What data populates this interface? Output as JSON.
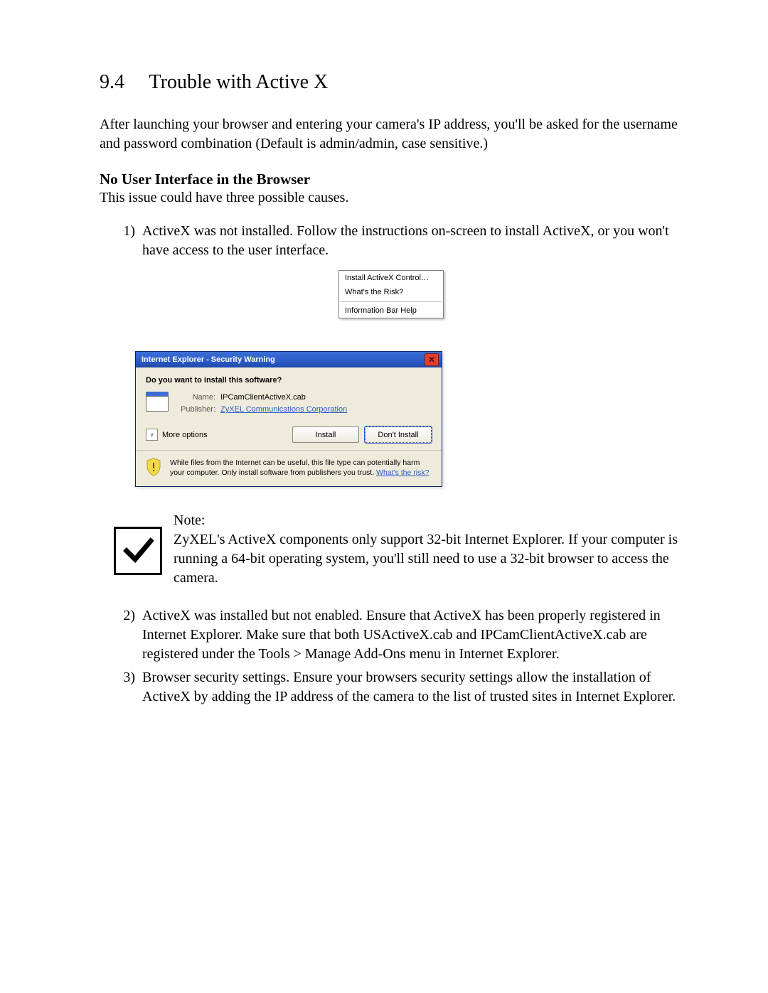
{
  "section": {
    "number": "9.4",
    "title": "Trouble with Active X"
  },
  "intro": "After launching your browser and entering your camera's IP address, you'll be asked for the username and password combination (Default is admin/admin, case sensitive.)",
  "subhead": "No User Interface in the Browser",
  "sublead": "This issue could have three possible causes.",
  "steps": {
    "s1": {
      "marker": "1)",
      "text": "ActiveX was not installed. Follow the instructions on-screen to install ActiveX, or you won't have access to the user interface."
    },
    "s2": {
      "marker": "2)",
      "text": "ActiveX was installed but not enabled. Ensure that ActiveX has been properly registered in Internet Explorer. Make sure that both USActiveX.cab and IPCamClientActiveX.cab are registered under the Tools > Manage Add-Ons menu in Internet Explorer."
    },
    "s3": {
      "marker": "3)",
      "text": "Browser security settings. Ensure your browsers security settings allow the installation of ActiveX by adding the IP address of the camera to the list of trusted sites in Internet Explorer."
    }
  },
  "context_menu": {
    "install": "Install ActiveX Control…",
    "risk": "What's the Risk?",
    "help": "Information Bar Help"
  },
  "dialog": {
    "title": "Internet Explorer - Security Warning",
    "question": "Do you want to install this software?",
    "name_label": "Name:",
    "name_value": "IPCamClientActiveX.cab",
    "publisher_label": "Publisher:",
    "publisher_value": "ZyXEL Communications Corporation",
    "more_options": "More options",
    "install_btn": "Install",
    "dont_install_btn": "Don't Install",
    "footer_text": "While files from the Internet can be useful, this file type can potentially harm your computer. Only install software from publishers you trust.",
    "footer_link": "What's the risk?"
  },
  "note": {
    "label": "Note:",
    "text": "ZyXEL's ActiveX components only support 32-bit Internet Explorer. If your computer is running a 64-bit operating system, you'll still need to use a 32-bit browser to access the camera."
  }
}
